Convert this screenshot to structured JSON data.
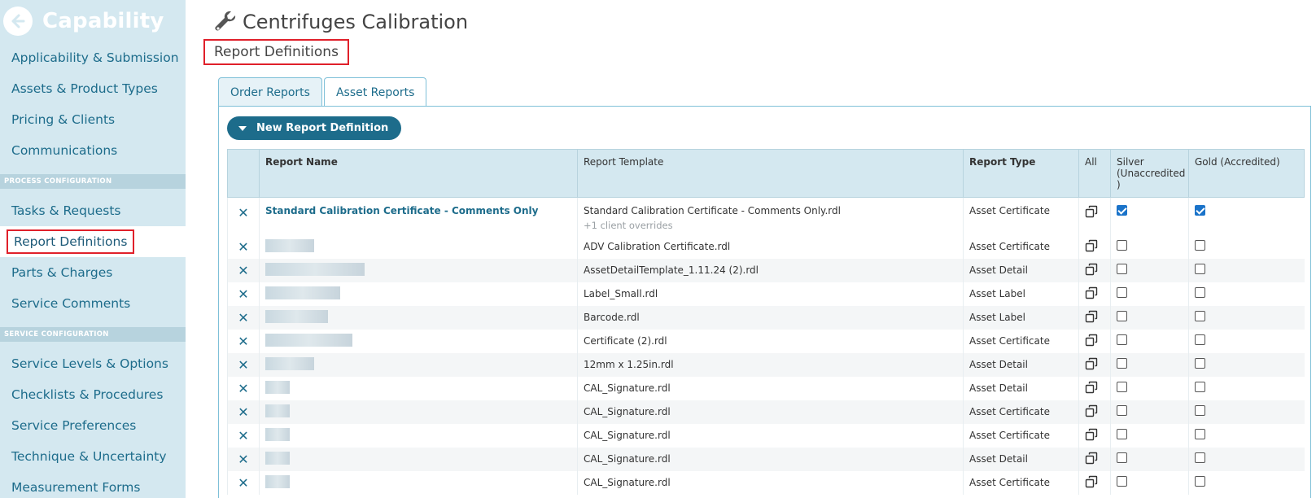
{
  "sidebar": {
    "title": "Capability",
    "items_top": [
      {
        "label": "Applicability & Submission"
      },
      {
        "label": "Assets & Product Types"
      },
      {
        "label": "Pricing & Clients"
      },
      {
        "label": "Communications"
      }
    ],
    "section_process": "PROCESS CONFIGURATION",
    "items_process": [
      {
        "label": "Tasks & Requests"
      },
      {
        "label": "Report Definitions"
      },
      {
        "label": "Parts & Charges"
      },
      {
        "label": "Service Comments"
      }
    ],
    "section_service": "SERVICE CONFIGURATION",
    "items_service": [
      {
        "label": "Service Levels & Options"
      },
      {
        "label": "Checklists & Procedures"
      },
      {
        "label": "Service Preferences"
      },
      {
        "label": "Technique & Uncertainty"
      },
      {
        "label": "Measurement Forms"
      }
    ]
  },
  "header": {
    "title": "Centrifuges Calibration",
    "subtitle": "Report Definitions"
  },
  "tabs": [
    {
      "label": "Order Reports"
    },
    {
      "label": "Asset Reports"
    }
  ],
  "new_button_label": "New Report Definition",
  "table": {
    "headers": {
      "name": "Report Name",
      "template": "Report Template",
      "type": "Report Type",
      "all": "All",
      "silver": "Silver (Unaccredited )",
      "gold": "Gold (Accredited)"
    },
    "first_row": {
      "name": "Standard Calibration Certificate - Comments Only",
      "template": "Standard Calibration Certificate - Comments Only.rdl",
      "override": "+1 client overrides",
      "type": "Asset Certificate"
    },
    "rows": [
      {
        "template": "ADV Calibration Certificate.rdl",
        "type": "Asset Certificate"
      },
      {
        "template": "AssetDetailTemplate_1.11.24 (2).rdl",
        "type": "Asset Detail"
      },
      {
        "template": "Label_Small.rdl",
        "type": "Asset Label"
      },
      {
        "template": "Barcode.rdl",
        "type": "Asset Label"
      },
      {
        "template": "Certificate (2).rdl",
        "type": "Asset Certificate"
      },
      {
        "template": "12mm x 1.25in.rdl",
        "type": "Asset Detail"
      },
      {
        "template": "CAL_Signature.rdl",
        "type": "Asset Detail"
      },
      {
        "template": "CAL_Signature.rdl",
        "type": "Asset Certificate"
      },
      {
        "template": "CAL_Signature.rdl",
        "type": "Asset Certificate"
      },
      {
        "template": "CAL_Signature.rdl",
        "type": "Asset Detail"
      },
      {
        "template": "CAL_Signature.rdl",
        "type": "Asset Certificate"
      }
    ]
  },
  "icons": {
    "back": "arrow-left-circle-icon",
    "title": "wrench-icon",
    "remove": "close-icon",
    "copy": "copy-icon"
  },
  "colors": {
    "accent": "#1d6c8b",
    "sidebar_bg": "#d4e8f0",
    "highlight_box": "#e0202a",
    "checkbox_on": "#1a73c9"
  }
}
